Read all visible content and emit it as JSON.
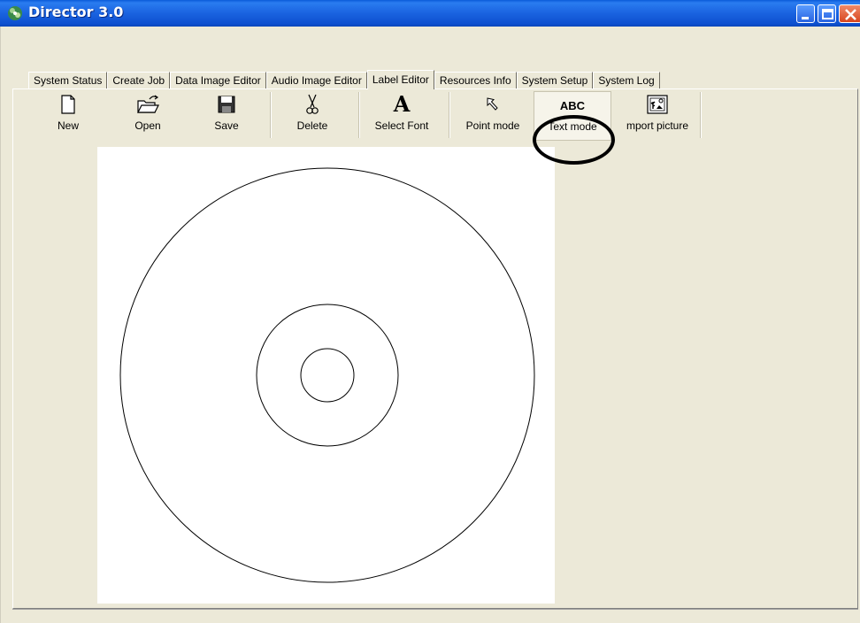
{
  "window": {
    "title": "Director 3.0"
  },
  "tabs": [
    {
      "label": "System Status"
    },
    {
      "label": "Create Job"
    },
    {
      "label": "Data Image Editor"
    },
    {
      "label": "Audio Image Editor"
    },
    {
      "label": "Label Editor",
      "active": true
    },
    {
      "label": "Resources Info"
    },
    {
      "label": "System Setup"
    },
    {
      "label": "System Log"
    }
  ],
  "toolbar": {
    "new_label": "New",
    "open_label": "Open",
    "save_label": "Save",
    "delete_label": "Delete",
    "select_font_label": "Select Font",
    "point_mode_label": "Point mode",
    "text_mode_label": "Text mode",
    "text_mode_icon": "ABC",
    "select_font_icon": "A",
    "import_picture_label": "mport picture"
  },
  "colors": {
    "titlebar": "#0a5ad8",
    "background": "#ece9d8",
    "canvas": "#ffffff"
  }
}
